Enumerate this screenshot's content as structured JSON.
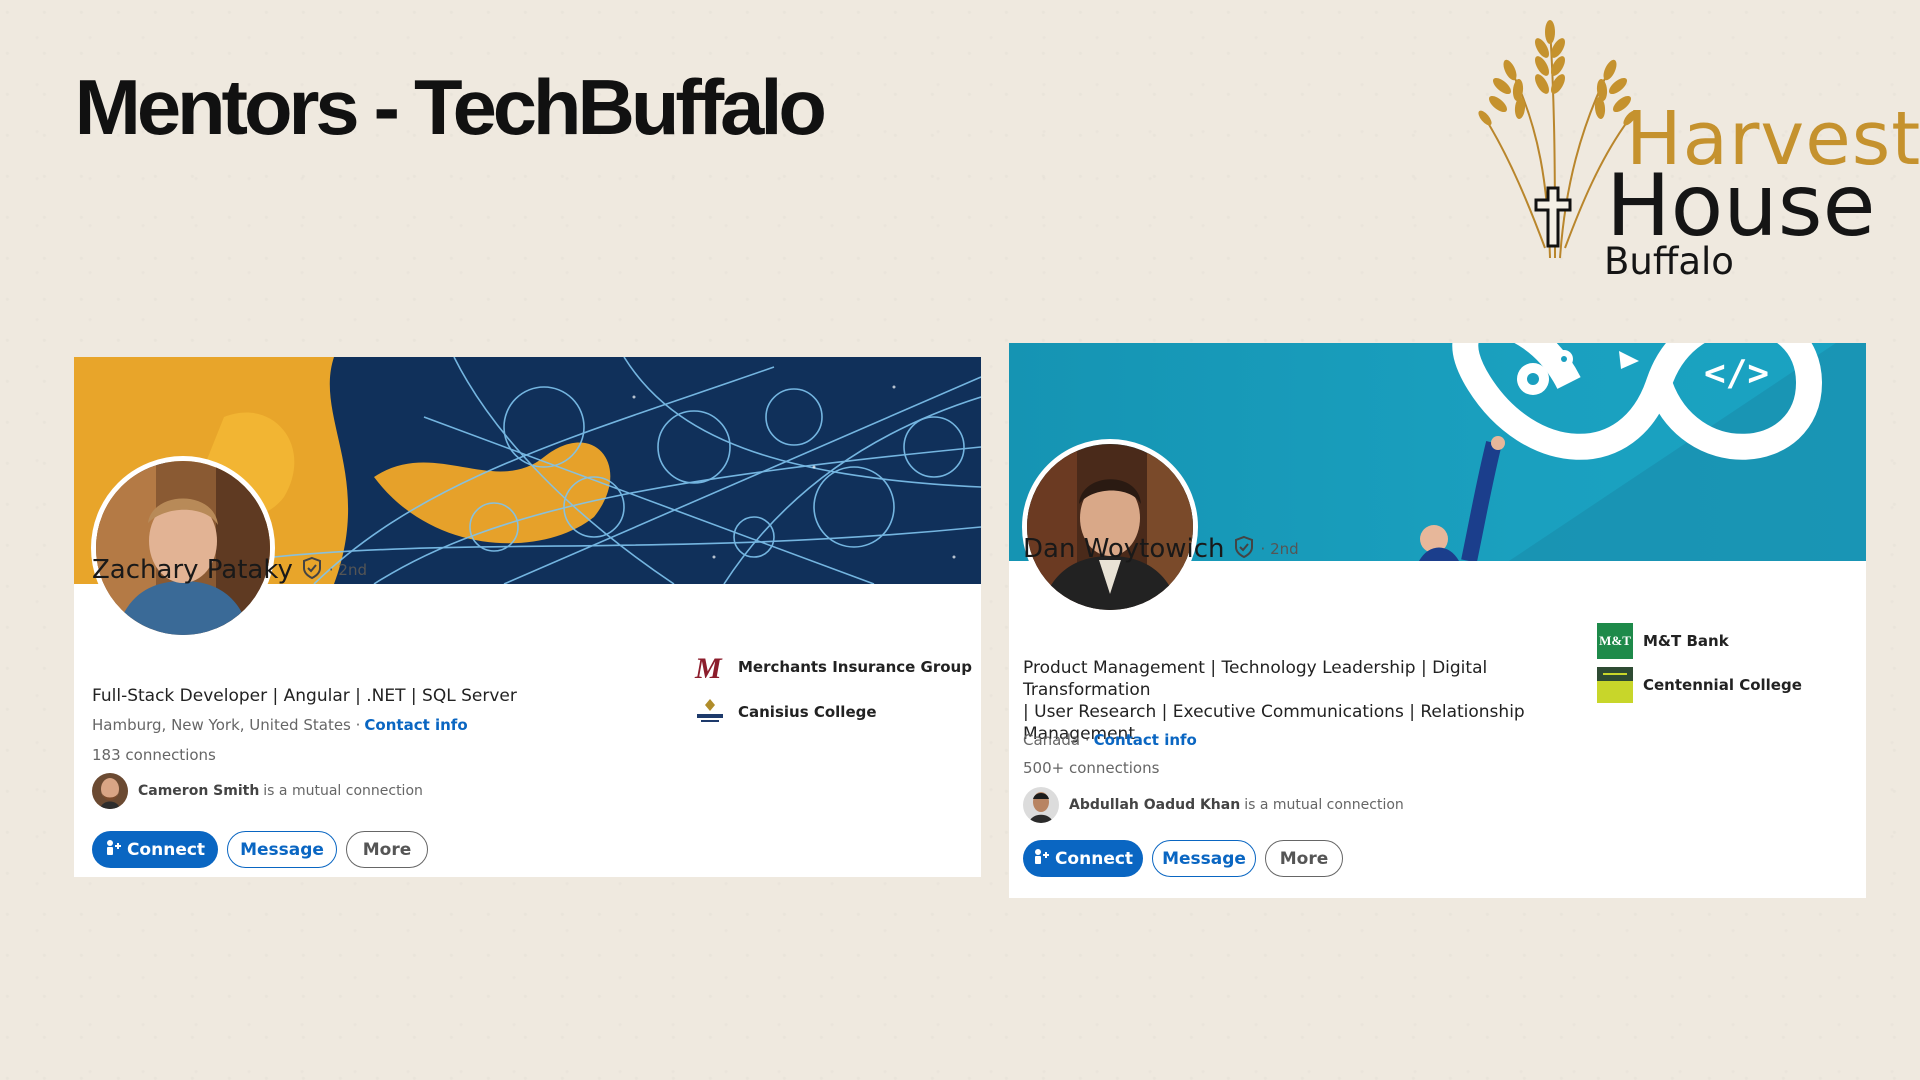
{
  "slide": {
    "title": "Mentors - TechBuffalo"
  },
  "logo": {
    "line1": "Harvest",
    "line2": "House",
    "line3": "Buffalo"
  },
  "colors": {
    "linkedin_blue": "#0a66c2",
    "logo_gold": "#c5922e",
    "slide_bg": "#efe9df"
  },
  "profiles": [
    {
      "name": "Zachary Pataky",
      "degree": "· 2nd",
      "headline": "Full-Stack Developer | Angular | .NET | SQL Server",
      "location": "Hamburg, New York, United States ·",
      "contact_label": "Contact info",
      "connections": "183 connections",
      "mutual_name": "Cameron Smith",
      "mutual_text": "is a mutual connection",
      "buttons": {
        "connect": "Connect",
        "message": "Message",
        "more": "More"
      },
      "orgs": [
        {
          "name": "Merchants Insurance Group",
          "icon": "merchants-logo-icon"
        },
        {
          "name": "Canisius College",
          "icon": "canisius-logo-icon"
        }
      ]
    },
    {
      "name": "Dan Woytowich",
      "degree": "· 2nd",
      "headline_lines": [
        "Product Management | Technology Leadership | Digital Transformation",
        "| User Research | Executive Communications | Relationship",
        "Management"
      ],
      "location": "Canada ·",
      "contact_label": "Contact info",
      "connections": "500+ connections",
      "mutual_name": "Abdullah Oadud Khan",
      "mutual_text": "is a mutual connection",
      "buttons": {
        "connect": "Connect",
        "message": "Message",
        "more": "More"
      },
      "orgs": [
        {
          "name": "M&T Bank",
          "icon": "mt-bank-logo-icon",
          "logo_text": "M&T"
        },
        {
          "name": "Centennial College",
          "icon": "centennial-logo-icon"
        }
      ]
    }
  ]
}
